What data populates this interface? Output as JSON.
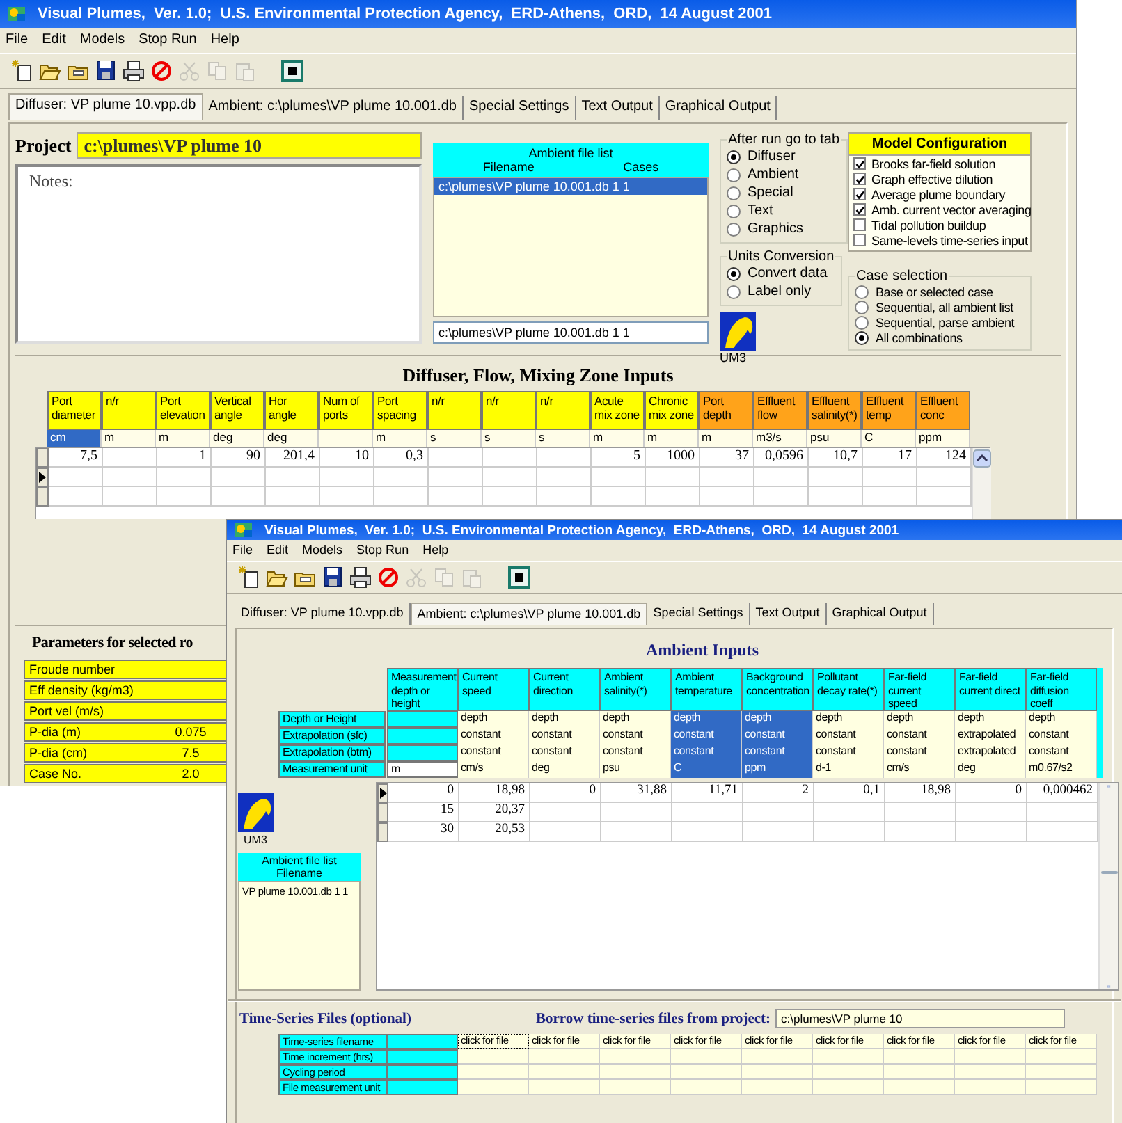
{
  "diffuser_window": {
    "title": "Visual Plumes,  Ver. 1.0;  U.S. Environmental Protection Agency,  ERD-Athens,  ORD,  14 August 2001",
    "menu": [
      "File",
      "Edit",
      "Models",
      "Stop Run",
      "Help"
    ],
    "toolbar": [
      {
        "kind": "new",
        "disabled": false
      },
      {
        "kind": "open",
        "disabled": false
      },
      {
        "kind": "folder",
        "disabled": false
      },
      {
        "kind": "save",
        "disabled": false
      },
      {
        "kind": "print",
        "disabled": false
      },
      {
        "kind": "stop",
        "disabled": false
      },
      {
        "kind": "cut",
        "disabled": true
      },
      {
        "kind": "copy",
        "disabled": true
      },
      {
        "kind": "paste",
        "disabled": true
      },
      {
        "kind": "run",
        "disabled": false
      }
    ],
    "tabs": [
      {
        "label": "Diffuser: VP plume 10.vpp.db",
        "selected": true
      },
      {
        "label": "Ambient: c:\\plumes\\VP plume 10.001.db",
        "selected": false
      },
      {
        "label": "Special Settings",
        "selected": false
      },
      {
        "label": "Text Output",
        "selected": false
      },
      {
        "label": "Graphical Output",
        "selected": false
      }
    ],
    "project": {
      "label": "Project",
      "value": "c:\\plumes\\VP plume 10"
    },
    "notes": {
      "value": "Notes:"
    },
    "ambient_files": {
      "title": "Ambient file list",
      "columns": [
        "Filename",
        "Cases"
      ],
      "items": [
        {
          "text": "c:\\plumes\\VP plume 10.001.db 1 1",
          "selected": true
        }
      ],
      "field_value": "c:\\plumes\\VP plume 10.001.db 1 1"
    },
    "after_run": {
      "title": "After run go to tab",
      "options": [
        {
          "label": "Diffuser",
          "selected": true
        },
        {
          "label": "Ambient",
          "selected": false
        },
        {
          "label": "Special",
          "selected": false
        },
        {
          "label": "Text",
          "selected": false
        },
        {
          "label": "Graphics",
          "selected": false
        }
      ]
    },
    "units_conversion": {
      "title": "Units Conversion",
      "options": [
        {
          "label": "Convert data",
          "selected": true
        },
        {
          "label": "Label only",
          "selected": false
        }
      ]
    },
    "model_label": "UM3",
    "model_configuration": {
      "title": "Model Configuration",
      "options": [
        {
          "label": "Brooks far-field solution",
          "checked": true
        },
        {
          "label": "Graph effective dilution",
          "checked": true
        },
        {
          "label": "Average plume boundary",
          "checked": true
        },
        {
          "label": "Amb. current vector averaging",
          "checked": true
        },
        {
          "label": "Tidal pollution buildup",
          "checked": false
        },
        {
          "label": "Same-levels time-series input",
          "checked": false
        }
      ]
    },
    "case_selection": {
      "title": "Case selection",
      "options": [
        {
          "label": "Base or selected case",
          "selected": false
        },
        {
          "label": "Sequential, all ambient list",
          "selected": false
        },
        {
          "label": "Sequential, parse ambient",
          "selected": false
        },
        {
          "label": "All combinations",
          "selected": true
        }
      ]
    },
    "inputs": {
      "title": "Diffuser, Flow, Mixing Zone Inputs",
      "columns": [
        {
          "label": "Port diameter",
          "unit": "cm",
          "kind": "diffuser",
          "selected": true
        },
        {
          "label": "n/r",
          "unit": "m",
          "kind": "diffuser",
          "selected": false
        },
        {
          "label": "Port elevation",
          "unit": "m",
          "kind": "diffuser",
          "selected": false
        },
        {
          "label": "Vertical angle",
          "unit": "deg",
          "kind": "diffuser",
          "selected": false
        },
        {
          "label": "Hor angle",
          "unit": "deg",
          "kind": "diffuser",
          "selected": false
        },
        {
          "label": "Num of ports",
          "kind": "diffuser",
          "selected": false
        },
        {
          "label": "Port spacing",
          "unit": "m",
          "kind": "diffuser",
          "selected": false
        },
        {
          "label": "n/r",
          "unit": "s",
          "kind": "diffuser",
          "selected": false
        },
        {
          "label": "n/r",
          "unit": "s",
          "kind": "diffuser",
          "selected": false
        },
        {
          "label": "n/r",
          "unit": "s",
          "kind": "diffuser",
          "selected": false
        },
        {
          "label": "Acute mix zone",
          "unit": "m",
          "kind": "diffuser",
          "selected": false
        },
        {
          "label": "Chronic mix zone",
          "unit": "m",
          "kind": "diffuser",
          "selected": false
        },
        {
          "label": "Port depth",
          "unit": "m",
          "kind": "effluent",
          "selected": false
        },
        {
          "label": "Effluent flow",
          "unit": "m3/s",
          "kind": "effluent",
          "selected": false
        },
        {
          "label": "Effluent salinity(*)",
          "unit": "psu",
          "kind": "effluent",
          "selected": false
        },
        {
          "label": "Effluent temp",
          "unit": "C",
          "kind": "effluent",
          "selected": false
        },
        {
          "label": "Effluent conc",
          "unit": "ppm",
          "kind": "effluent",
          "selected": false
        }
      ],
      "rows": [
        {
          "current": false,
          "cells": [
            "7,5",
            null,
            "1",
            "90",
            "201,4",
            "10",
            "0,3",
            null,
            null,
            null,
            "5",
            "1000",
            "37",
            "0,0596",
            "10,7",
            "17",
            "124"
          ]
        },
        {
          "current": true
        },
        {
          "current": false
        }
      ]
    },
    "parameters": {
      "title": "Parameters for selected ro",
      "rows": [
        {
          "label": "Froude number"
        },
        {
          "label": "Eff density (kg/m3)"
        },
        {
          "label": "Port vel (m/s)"
        },
        {
          "label": "P-dia (m)",
          "value": "0.075"
        },
        {
          "label": "P-dia (cm)",
          "value": "7.5"
        },
        {
          "label": "Case No.",
          "value": "2.0"
        }
      ]
    }
  },
  "ambient_window": {
    "title": "Visual Plumes,  Ver. 1.0;  U.S. Environmental Protection Agency,  ERD-Athens,  ORD,  14 August 2001",
    "menu": [
      "File",
      "Edit",
      "Models",
      "Stop Run",
      "Help"
    ],
    "toolbar": [
      {
        "kind": "new",
        "disabled": false
      },
      {
        "kind": "open",
        "disabled": false
      },
      {
        "kind": "folder",
        "disabled": false
      },
      {
        "kind": "save",
        "disabled": false
      },
      {
        "kind": "print",
        "disabled": false
      },
      {
        "kind": "stop",
        "disabled": false
      },
      {
        "kind": "cut",
        "disabled": true
      },
      {
        "kind": "copy",
        "disabled": true
      },
      {
        "kind": "paste",
        "disabled": true
      },
      {
        "kind": "run",
        "disabled": false
      }
    ],
    "tabs": [
      {
        "label": "Diffuser: VP plume 10.vpp.db",
        "selected": false
      },
      {
        "label": "Ambient: c:\\plumes\\VP plume 10.001.db",
        "selected": true
      },
      {
        "label": "Special Settings",
        "selected": false
      },
      {
        "label": "Text Output",
        "selected": false
      },
      {
        "label": "Graphical Output",
        "selected": false
      }
    ],
    "heading": "Ambient Inputs",
    "columns": [
      {
        "label": "Measurement depth or height",
        "selected": false
      },
      {
        "label": "Current speed",
        "selected": false
      },
      {
        "label": "Current direction",
        "selected": false
      },
      {
        "label": "Ambient salinity(*)",
        "selected": false
      },
      {
        "label": "Ambient temperature",
        "selected": true
      },
      {
        "label": "Background concentration",
        "selected": true
      },
      {
        "label": "Pollutant decay rate(*)",
        "selected": false
      },
      {
        "label": "Far-field current speed",
        "selected": false
      },
      {
        "label": "Far-field current direct",
        "selected": false
      },
      {
        "label": "Far-field diffusion coeff",
        "selected": false
      }
    ],
    "attributes": [
      {
        "label": "Depth or Height",
        "cells": [
          null,
          "depth",
          "depth",
          "depth",
          "depth",
          "depth",
          "depth",
          "depth",
          "depth",
          "depth"
        ]
      },
      {
        "label": "Extrapolation (sfc)",
        "cells": [
          null,
          "constant",
          "constant",
          "constant",
          "constant",
          "constant",
          "constant",
          "constant",
          "extrapolated",
          "constant"
        ]
      },
      {
        "label": "Extrapolation (btm)",
        "cells": [
          null,
          "constant",
          "constant",
          "constant",
          "constant",
          "constant",
          "constant",
          "constant",
          "extrapolated",
          "constant"
        ]
      },
      {
        "label": "Measurement unit",
        "cells": [
          "m",
          "cm/s",
          "deg",
          "psu",
          "C",
          "ppm",
          "d-1",
          "cm/s",
          "deg",
          "m0.67/s2"
        ]
      }
    ],
    "rows": [
      {
        "current": true,
        "cells": [
          "0",
          "18,98",
          "0",
          "31,88",
          "11,71",
          "2",
          "0,1",
          "18,98",
          "0",
          "0,000462"
        ]
      },
      {
        "current": false,
        "cells": [
          "15",
          "20,37"
        ]
      },
      {
        "current": false,
        "cells": [
          "30",
          "20,53"
        ]
      }
    ],
    "model_label": "UM3",
    "ambient_files": {
      "title": "Ambient file list",
      "columns": [
        "Filename"
      ],
      "items": [
        {
          "text": "VP plume 10.001.db 1 1",
          "selected": false
        }
      ]
    },
    "time_series": {
      "title": "Time-Series Files (optional)",
      "borrow_label": "Borrow time-series files from project:",
      "borrow_value": "c:\\plumes\\VP plume 10",
      "rows": [
        {
          "label": "Time-series filename",
          "cells": [
            null,
            "click for file",
            "click for file",
            "click for file",
            "click for file",
            "click for file",
            "click for file",
            "click for file",
            "click for file",
            "click for file"
          ]
        },
        {
          "label": "Time increment (hrs)"
        },
        {
          "label": "Cycling period"
        },
        {
          "label": "File measurement unit"
        }
      ]
    }
  }
}
